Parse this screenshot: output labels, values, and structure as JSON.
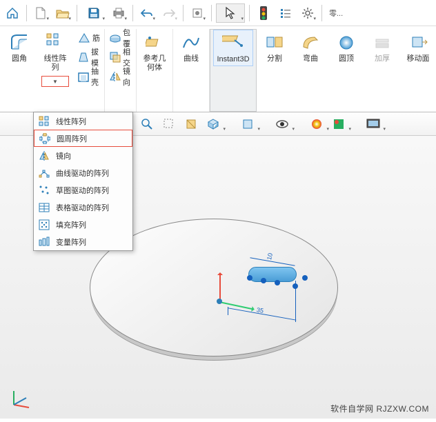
{
  "toolbar_top": {
    "search_placeholder": "零..."
  },
  "ribbon": {
    "fillet": "圆角",
    "linear_pattern": "线性阵\n列",
    "rib": "筋",
    "draft": "拔模",
    "shell": "抽壳",
    "wrap": "包覆",
    "intersect": "相交",
    "mirror": "镜向",
    "ref_geom": "参考几\n何体",
    "curve": "曲线",
    "instant3d": "Instant3D",
    "split": "分割",
    "bend": "弯曲",
    "dome": "圆顶",
    "thicken": "加厚",
    "move_face": "移动面"
  },
  "dropdown": {
    "items": [
      {
        "label": "线性阵列"
      },
      {
        "label": "圆周阵列"
      },
      {
        "label": "镜向"
      },
      {
        "label": "曲线驱动的阵列"
      },
      {
        "label": "草图驱动的阵列"
      },
      {
        "label": "表格驱动的阵列"
      },
      {
        "label": "填充阵列"
      },
      {
        "label": "变量阵列"
      }
    ]
  },
  "canvas": {
    "dim1": "10",
    "dim2": "35"
  },
  "watermark": "软件自学网  RJZXW.COM"
}
